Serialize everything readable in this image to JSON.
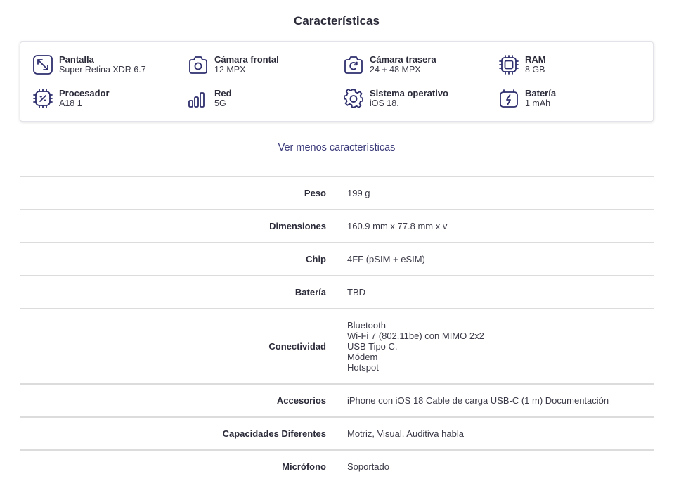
{
  "title": "Características",
  "features": [
    {
      "label": "Pantalla",
      "value": "Super Retina XDR 6.7",
      "icon": "expand-icon"
    },
    {
      "label": "Cámara frontal",
      "value": "12 MPX",
      "icon": "camera-icon"
    },
    {
      "label": "Cámara trasera",
      "value": "24 + 48 MPX",
      "icon": "camera-rotate-icon"
    },
    {
      "label": "RAM",
      "value": "8 GB",
      "icon": "memory-chip-icon"
    },
    {
      "label": "Procesador",
      "value": "A18 1",
      "icon": "processor-icon"
    },
    {
      "label": "Red",
      "value": "5G",
      "icon": "signal-bars-icon"
    },
    {
      "label": "Sistema operativo",
      "value": "iOS 18.",
      "icon": "gear-icon"
    },
    {
      "label": "Batería",
      "value": "1 mAh",
      "icon": "battery-charging-icon"
    }
  ],
  "toggle_label": "Ver menos características",
  "specs": [
    {
      "label": "Peso",
      "value": "199 g"
    },
    {
      "label": "Dimensiones",
      "value": "160.9 mm x 77.8 mm x v"
    },
    {
      "label": "Chip",
      "value": "4FF (pSIM + eSIM)"
    },
    {
      "label": "Batería",
      "value": "TBD"
    },
    {
      "label": "Conectividad",
      "lines": [
        "Bluetooth",
        "Wi-Fi 7 (802.11be) con MIMO 2x2",
        "USB Tipo C.",
        "Módem",
        "Hotspot"
      ]
    },
    {
      "label": "Accesorios",
      "value": "iPhone con iOS 18 Cable de carga USB-C (1 m) Documentación"
    },
    {
      "label": "Capacidades Diferentes",
      "value": "Motriz, Visual, Auditiva habla"
    },
    {
      "label": "Micrófono",
      "value": "Soportado"
    }
  ],
  "colors": {
    "icon_stroke": "#2f2f6e",
    "link": "#3b3a7a",
    "divider": "#dcdcdc"
  }
}
